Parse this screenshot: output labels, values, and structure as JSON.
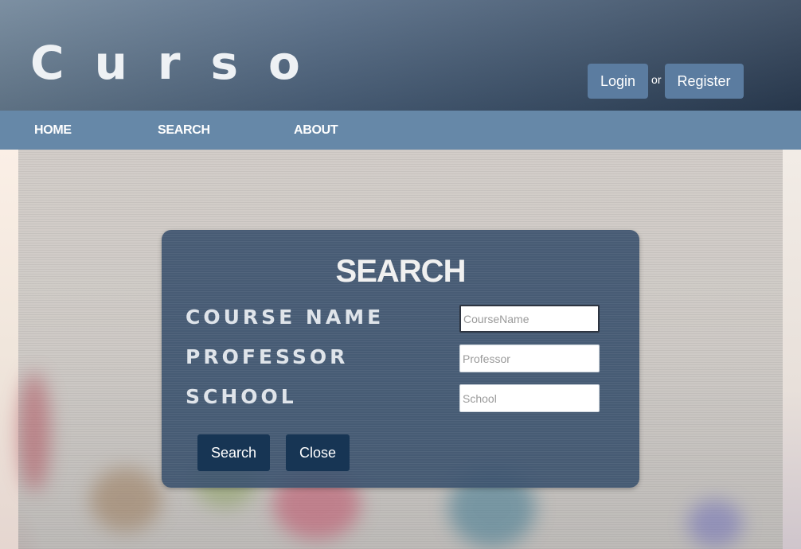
{
  "header": {
    "logo_text": "Curso",
    "login_label": "Login",
    "or_text": "or",
    "register_label": "Register"
  },
  "nav": {
    "items": [
      {
        "label": "HOME"
      },
      {
        "label": "SEARCH"
      },
      {
        "label": "ABOUT"
      }
    ]
  },
  "search_modal": {
    "title": "SEARCH",
    "fields": [
      {
        "label": "COURSE NAME",
        "placeholder": "CourseName",
        "value": ""
      },
      {
        "label": "PROFESSOR",
        "placeholder": "Professor",
        "value": ""
      },
      {
        "label": "SCHOOL",
        "placeholder": "School",
        "value": ""
      }
    ],
    "search_button": "Search",
    "close_button": "Close"
  },
  "colors": {
    "header": "#4e6580",
    "nav": "#6688a8",
    "auth_button": "#5b7ca0",
    "modal": "#3c526e",
    "modal_button": "#173554"
  }
}
